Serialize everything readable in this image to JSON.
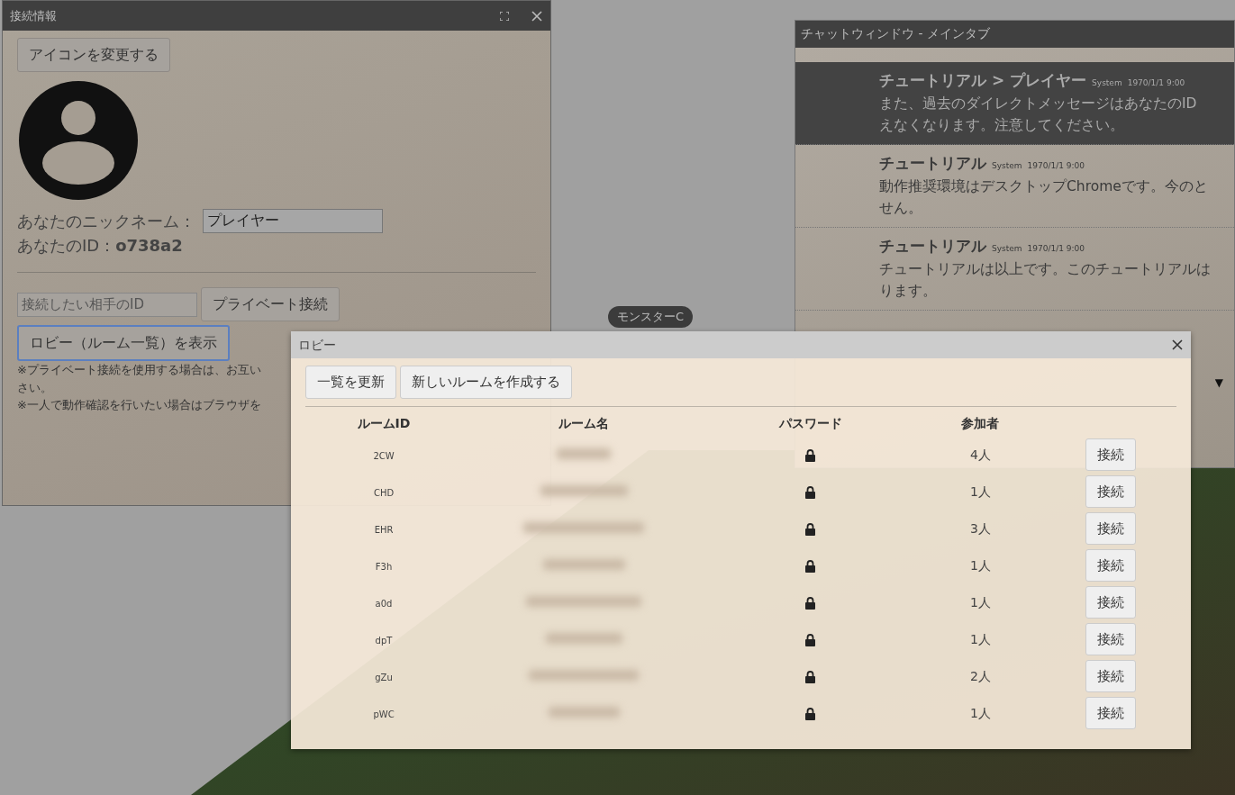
{
  "connection_window": {
    "title": "接続情報",
    "change_icon_button": "アイコンを変更する",
    "nickname_label": "あなたのニックネーム：",
    "nickname_value": "プレイヤー",
    "id_label": "あなたのID：",
    "id_value": "o738a2",
    "peer_id_placeholder": "接続したい相手のID",
    "private_connect_button": "プライベート接続",
    "show_lobby_button": {
      "label": "ロビー（ルーム一覧）を表示",
      "focused": true
    },
    "notes": [
      "※プライベート接続を使用する場合は、お互い",
      "さい。",
      "※一人で動作確認を行いたい場合はブラウザを"
    ]
  },
  "chat_window": {
    "title": "チャットウィンドウ - メインタブ",
    "messages": [
      {
        "sender": "チュートリアル > プレイヤー",
        "source": "System",
        "time": "1970/1/1 9:00",
        "lines": [
          "また、過去のダイレクトメッセージはあなたのID",
          "えなくなります。注意してください。"
        ],
        "highlighted": true
      },
      {
        "sender": "チュートリアル",
        "source": "System",
        "time": "1970/1/1 9:00",
        "lines": [
          "動作推奨環境はデスクトップChromeです。今のと",
          "せん。"
        ],
        "highlighted": false
      },
      {
        "sender": "チュートリアル",
        "source": "System",
        "time": "1970/1/1 9:00",
        "lines": [
          "チュートリアルは以上です。このチュートリアルは",
          "ります。"
        ],
        "highlighted": false
      }
    ],
    "channel_caret": "▼"
  },
  "map_tokens": [
    {
      "label": "モンスターC"
    }
  ],
  "lobby": {
    "title": "ロビー",
    "buttons": [
      "一覧を更新",
      "新しいルームを作成する"
    ],
    "columns": [
      "ルームID",
      "ルーム名",
      "パスワード",
      "参加者"
    ],
    "rows": [
      {
        "room_id": "2CW",
        "password": true,
        "participants": "4人",
        "join_button": "接続"
      },
      {
        "room_id": "CHD",
        "password": true,
        "participants": "1人",
        "join_button": "接続"
      },
      {
        "room_id": "EHR",
        "password": true,
        "participants": "3人",
        "join_button": "接続"
      },
      {
        "room_id": "F3h",
        "password": true,
        "participants": "1人",
        "join_button": "接続"
      },
      {
        "room_id": "a0d",
        "password": true,
        "participants": "1人",
        "join_button": "接続"
      },
      {
        "room_id": "dpT",
        "password": true,
        "participants": "1人",
        "join_button": "接続"
      },
      {
        "room_id": "gZu",
        "password": true,
        "participants": "2人",
        "join_button": "接続"
      },
      {
        "room_id": "pWC",
        "password": true,
        "participants": "1人",
        "join_button": "接続"
      }
    ]
  }
}
